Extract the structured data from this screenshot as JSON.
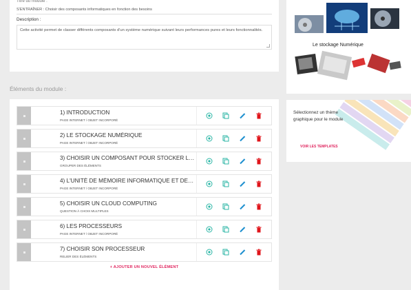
{
  "module": {
    "title_field_label": "Titre du module :",
    "title_value": "S'ENTRAÎNER : Choisir des composants informatiques en fonction des besoins",
    "description_label": "Description :",
    "description_value": "Cette activité permet de classer différents composants d'un système numérique suivant leurs performances pures et leurs fonctionnalités."
  },
  "elements_section_title": "Éléments du module :",
  "elements": [
    {
      "title": "1) INTRODUCTION",
      "type": "PAGE INTERNET / OBJET INCORPORÉ"
    },
    {
      "title": "2) LE STOCKAGE NUMÉRIQUE",
      "type": "PAGE INTERNET / OBJET INCORPORÉ"
    },
    {
      "title": "3) CHOISIR UN COMPOSANT POUR STOCKER LES DO...",
      "type": "GROUPER DES ÉLÉMENTS"
    },
    {
      "title": "4) L'UNITÉ DE MÉMOIRE INFORMATIQUE ET DES ORD...",
      "type": "PAGE INTERNET / OBJET INCORPORÉ"
    },
    {
      "title": "5) CHOISIR UN CLOUD COMPUTING",
      "type": "QUESTION À CHOIX MULTIPLES"
    },
    {
      "title": "6) LES PROCESSEURS",
      "type": "PAGE INTERNET / OBJET INCORPORÉ"
    },
    {
      "title": "7) CHOISIR SON PROCESSEUR",
      "type": "RELIER DES ÉLÉMENTS"
    }
  ],
  "add_element_label": "+ AJOUTER UN NOUVEL ÉLÉMENT",
  "storage_image_label": "Le stockage Numérique",
  "theme": {
    "text": "Sélectionnez un thème graphique pour le module",
    "link": "VOIR LES TEMPLATES"
  },
  "icons": {
    "view": "view-icon",
    "duplicate": "duplicate-icon",
    "edit": "pencil-icon",
    "delete": "trash-icon"
  },
  "colors": {
    "accent": "#e0245e",
    "action_teal": "#2bb6a6",
    "edit_blue": "#1d8fcf",
    "delete_red": "#e0151b",
    "handle_gray": "#c4c4c4"
  }
}
